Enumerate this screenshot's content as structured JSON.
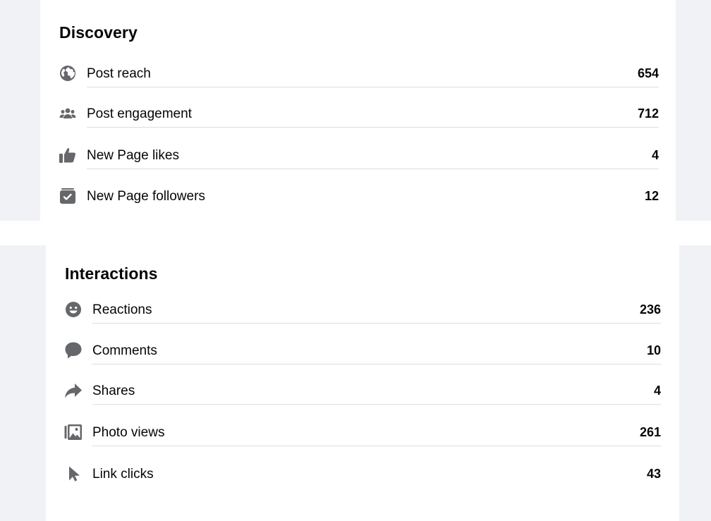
{
  "discovery": {
    "title": "Discovery",
    "rows": [
      {
        "label": "Post reach",
        "value": "654",
        "icon": "globe-icon"
      },
      {
        "label": "Post engagement",
        "value": "712",
        "icon": "people-group-icon"
      },
      {
        "label": "New Page likes",
        "value": "4",
        "icon": "thumbs-up-icon"
      },
      {
        "label": "New Page followers",
        "value": "12",
        "icon": "follow-check-icon"
      }
    ]
  },
  "interactions": {
    "title": "Interactions",
    "rows": [
      {
        "label": "Reactions",
        "value": "236",
        "icon": "smiley-face-icon"
      },
      {
        "label": "Comments",
        "value": "10",
        "icon": "speech-bubble-icon"
      },
      {
        "label": "Shares",
        "value": "4",
        "icon": "share-arrow-icon"
      },
      {
        "label": "Photo views",
        "value": "261",
        "icon": "photo-gallery-icon"
      },
      {
        "label": "Link clicks",
        "value": "43",
        "icon": "cursor-pointer-icon"
      }
    ]
  },
  "colors": {
    "icon": "#65676b",
    "text": "#050505",
    "divider": "#dadde1",
    "gutter": "#f0f2f5"
  }
}
